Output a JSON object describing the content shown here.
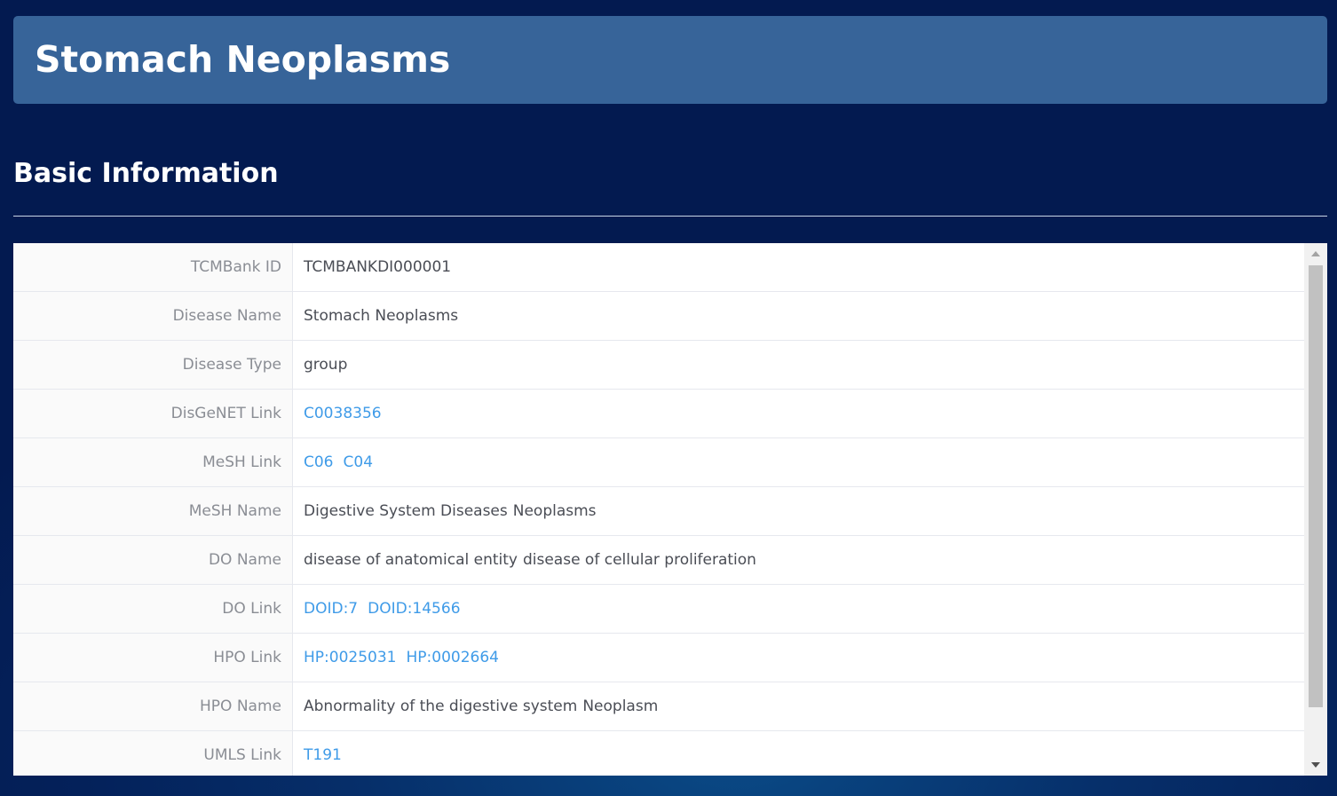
{
  "header": {
    "title": "Stomach Neoplasms"
  },
  "section": {
    "title": "Basic Information"
  },
  "table": {
    "rows": [
      {
        "label": "TCMBank ID",
        "values": [
          {
            "text": "TCMBANKDI000001",
            "link": false
          }
        ]
      },
      {
        "label": "Disease Name",
        "values": [
          {
            "text": "Stomach Neoplasms",
            "link": false
          }
        ]
      },
      {
        "label": "Disease Type",
        "values": [
          {
            "text": "group",
            "link": false
          }
        ]
      },
      {
        "label": "DisGeNET Link",
        "values": [
          {
            "text": "C0038356",
            "link": true
          }
        ]
      },
      {
        "label": "MeSH Link",
        "values": [
          {
            "text": "C06",
            "link": true
          },
          {
            "text": "C04",
            "link": true
          }
        ]
      },
      {
        "label": "MeSH Name",
        "values": [
          {
            "text": "Digestive System Diseases",
            "link": false
          },
          {
            "text": "Neoplasms",
            "link": false
          }
        ]
      },
      {
        "label": "DO Name",
        "values": [
          {
            "text": "disease of anatomical entity",
            "link": false
          },
          {
            "text": "disease of cellular proliferation",
            "link": false
          }
        ]
      },
      {
        "label": "DO Link",
        "values": [
          {
            "text": "DOID:7",
            "link": true
          },
          {
            "text": "DOID:14566",
            "link": true
          }
        ]
      },
      {
        "label": "HPO Link",
        "values": [
          {
            "text": "HP:0025031",
            "link": true
          },
          {
            "text": "HP:0002664",
            "link": true
          }
        ]
      },
      {
        "label": "HPO Name",
        "values": [
          {
            "text": "Abnormality of the digestive system",
            "link": false
          },
          {
            "text": "Neoplasm",
            "link": false
          }
        ]
      },
      {
        "label": "UMLS Link",
        "values": [
          {
            "text": "T191",
            "link": true
          }
        ]
      }
    ]
  },
  "scrollbar": {
    "up_icon": "triangle-up-icon",
    "down_icon": "triangle-down-icon"
  },
  "colors": {
    "title_bar": "#376499",
    "link": "#3f9be8",
    "label_text": "#8a8d94",
    "value_text": "#4a4d55",
    "background": "#04215a"
  }
}
